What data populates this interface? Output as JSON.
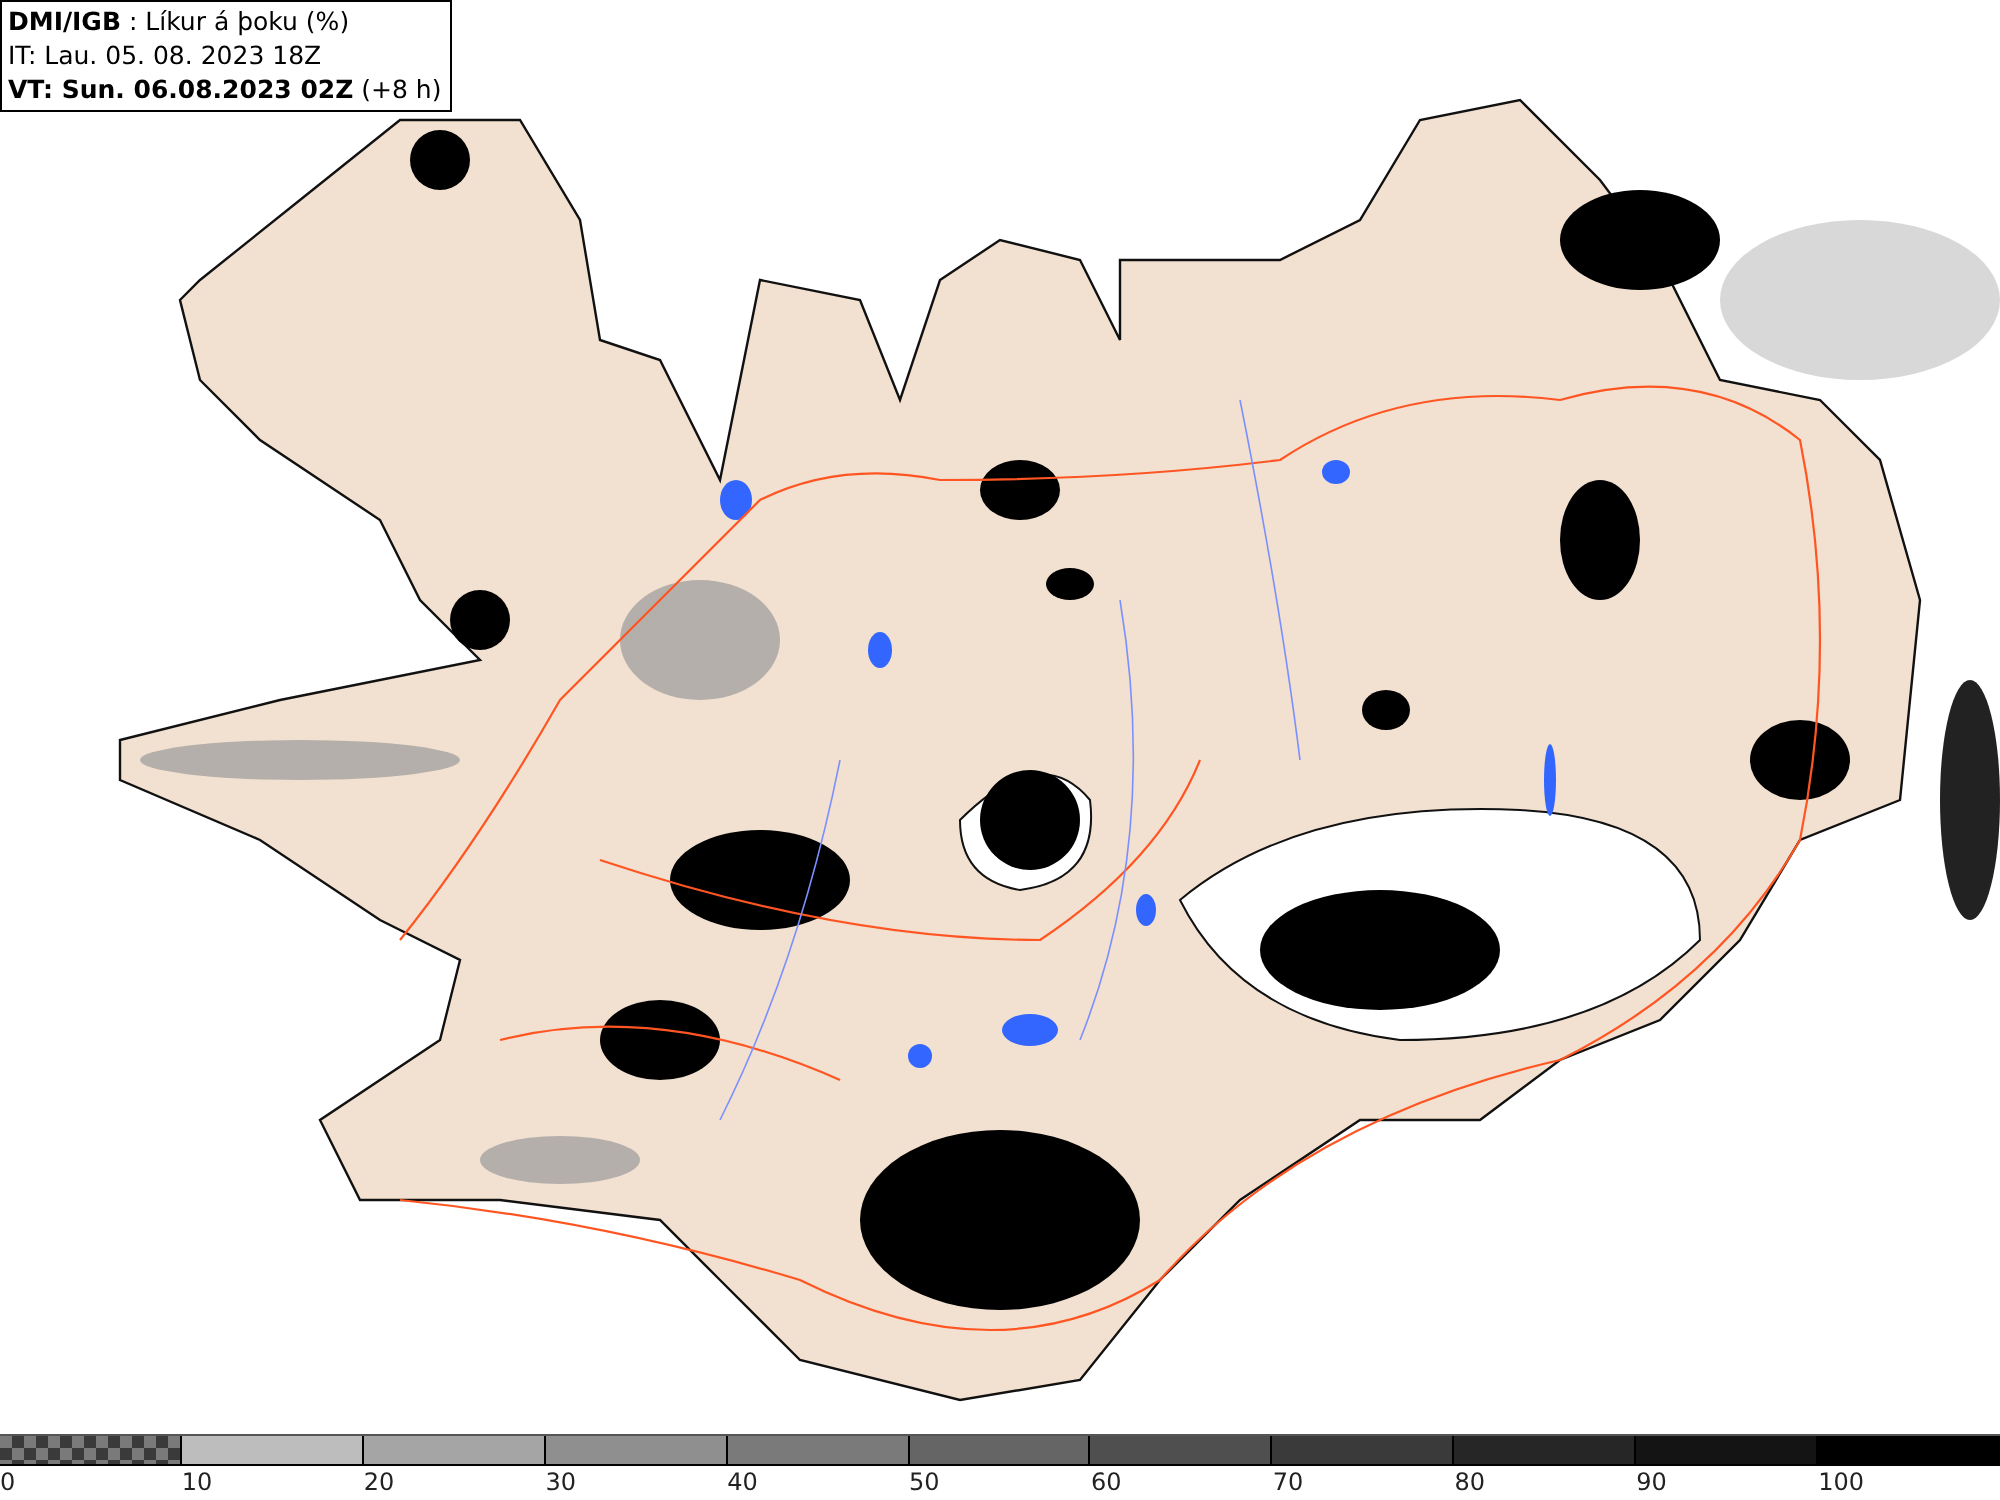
{
  "title_box": {
    "lines": [
      "**DMI/IGB** : Líkur á þoku (%)",
      "IT: Lau. 05. 08. 2023 18Z",
      "**VT: Sun. 06.08.2023 02Z** (+8 h)"
    ]
  },
  "legend": {
    "segments": [
      {
        "kind": "checker",
        "color": "#7a7a7a"
      },
      {
        "kind": "solid",
        "color": "#bdbdbd"
      },
      {
        "kind": "solid",
        "color": "#a5a5a5"
      },
      {
        "kind": "solid",
        "color": "#8f8f8f"
      },
      {
        "kind": "solid",
        "color": "#7a7a7a"
      },
      {
        "kind": "solid",
        "color": "#656565"
      },
      {
        "kind": "solid",
        "color": "#4f4f4f"
      },
      {
        "kind": "solid",
        "color": "#3a3a3a"
      },
      {
        "kind": "solid",
        "color": "#262626"
      },
      {
        "kind": "solid",
        "color": "#141414"
      },
      {
        "kind": "solid",
        "color": "#000000"
      }
    ],
    "labels": [
      "0",
      "10",
      "20",
      "30",
      "40",
      "50",
      "60",
      "70",
      "80",
      "90",
      "100"
    ]
  }
}
